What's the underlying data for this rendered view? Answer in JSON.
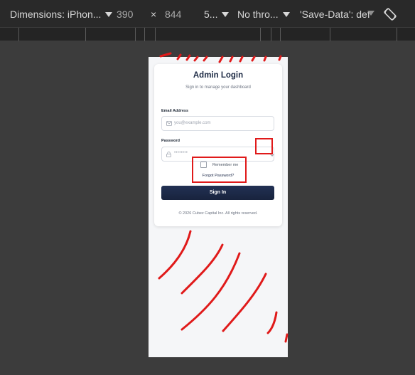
{
  "devtools": {
    "device_label": "Dimensions: iPhon...",
    "width_value": "390",
    "times_symbol": "×",
    "height_value": "844",
    "zoom_label": "5...",
    "throttle_label": "No thro...",
    "save_data_label": "'Save-Data': def"
  },
  "login": {
    "title": "Admin Login",
    "subtitle": "Sign in to manage your dashboard",
    "email_label": "Email Address",
    "email_placeholder": "you@example.com",
    "password_label": "Password",
    "password_placeholder": "••••••••",
    "remember_label": "Remember me",
    "forgot_label": "Forgot Password?",
    "signin_label": "Sign In",
    "footer": "© 2026 Cubez Capital Inc. All rights reserved."
  },
  "colors": {
    "annotation": "#e01a1a",
    "button": "#1d2a47",
    "toolbar": "#292929"
  },
  "icons": [
    "caret-down-icon",
    "rotate-icon",
    "mail-icon",
    "lock-icon",
    "chevron-down-icon"
  ]
}
